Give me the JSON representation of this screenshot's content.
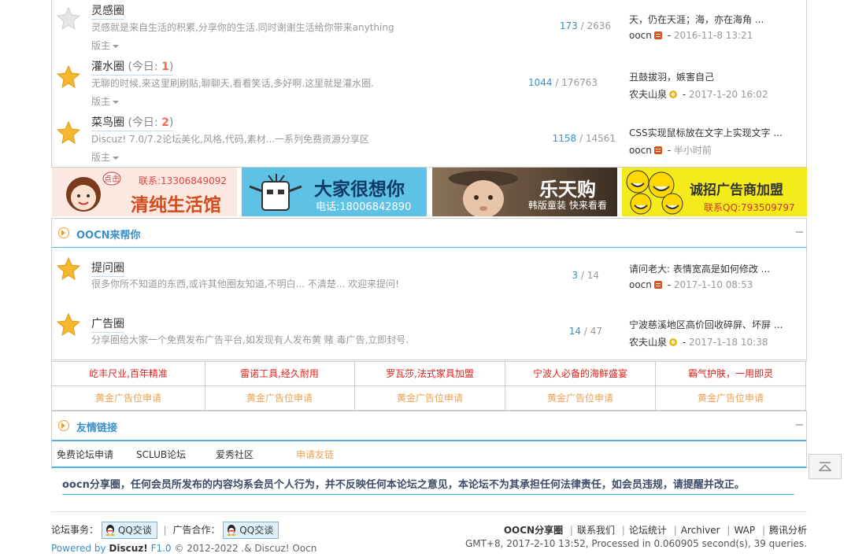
{
  "forums_top": [
    {
      "name": "灵感圈",
      "today": "",
      "today_label": "",
      "desc": "灵感就是来自生活的积累,分享你的生活.同时谢谢生活给你带来anything",
      "mod": "版主",
      "threads": "173",
      "posts": "2636",
      "last_title": "天，仍在天涯；海，亦在海角 ...",
      "last_user": "oocn",
      "last_time": "2016-11-8 13:21",
      "star": "gray",
      "medal": "red"
    },
    {
      "name": "灌水圈",
      "today": "1",
      "today_label": "今日: ",
      "desc": "无聊的时候,来这里刷刷贴,聊聊天,看看笑话,多好啊.这里就是灌水圈.",
      "mod": "版主",
      "threads": "1044",
      "posts": "176763",
      "last_title": "丑鼓拔羽，嫉害自己",
      "last_user": "农夫山泉",
      "last_time": "2017-1-20 16:02",
      "star": "gold",
      "medal": "gold"
    },
    {
      "name": "菜鸟圈",
      "today": "2",
      "today_label": "今日: ",
      "desc": "Discuz! 7.0/7.2论坛美化,风格,代码,素材...一系列免费资源分享区",
      "mod": "版主",
      "threads": "1158",
      "posts": "14561",
      "last_title": "CSS实现鼠标放在文字上实现文字 ...",
      "last_user": "oocn",
      "last_time": "半小时前",
      "star": "gold",
      "medal": "red"
    }
  ],
  "banners": [
    {
      "main": "清纯生活馆",
      "sub": "联系:13306849092",
      "bubble": "点击",
      "bg": "#fbe8e0"
    },
    {
      "main": "大家很想你",
      "sub": "电话:18006842890",
      "bg": "#5ec2e6"
    },
    {
      "main": "乐天购",
      "sub": "韩版童装 快来看看",
      "bg": "#6b5a48"
    },
    {
      "main": "诚招广告商加盟",
      "sub": "联系QQ:793509797",
      "bg": "#f5ea1a"
    }
  ],
  "section_help": {
    "title": "OOCN来帮你",
    "fold_icon": "collapse-icon"
  },
  "forums_help": [
    {
      "name": "提问圈",
      "desc": "很多你所不知道的东西,或许其他圈友知道,不明白... 不清楚... 欢迎来提问!",
      "threads": "3",
      "posts": "14",
      "last_title": "请问老大: 表情宽高是如何修改 ...",
      "last_user": "oocn",
      "last_time": "2017-1-10 08:53",
      "medal": "red"
    },
    {
      "name": "广告圈",
      "desc": "分享圈给大家一个免费发布广告平台,如发现有人发布黄 赌 毒广告,立即封号.",
      "threads": "14",
      "posts": "47",
      "last_title": "宁波慈溪地区高价回收碎屏、坏屏 ...",
      "last_user": "农夫山泉",
      "last_time": "2017-1-18 10:38",
      "medal": "gold"
    }
  ],
  "ads_row1": [
    "屹丰尺业,百年精准",
    "雷诺工具,经久耐用",
    "罗瓦莎,法式家具加盟",
    "宁波人必备的海鲜盛宴",
    "霸气护肤，一用即灵"
  ],
  "ads_row2": [
    "黄金广告位申请",
    "黄金广告位申请",
    "黄金广告位申请",
    "黄金广告位申请",
    "黄金广告位申请"
  ],
  "section_links": {
    "title": "友情链接"
  },
  "links": [
    "免费论坛申请",
    "SCLUB论坛",
    "爱秀社区",
    "申请友链"
  ],
  "notice": "oocn分享圈，任何会员所发布的内容均系会员个人行为，并不反映任何本论坛之意见，本论坛不为其承担任何法律责任，如会员违规，请提醒并改正。",
  "footer": {
    "affairs_label": "论坛事务：",
    "qq1": "QQ交谈",
    "sep": "|",
    "ad_label": "广告合作：",
    "qq2": "QQ交谈",
    "powered": "Powered by",
    "discuz": "Discuz!",
    "version": "F1.0",
    "copyright": "© 2012-2022 .& Discuz! Oocn",
    "nav": [
      "OOCN分享圈",
      "联系我们",
      "论坛统计",
      "Archiver",
      "WAP",
      "腾讯分析"
    ],
    "stats": "GMT+8, 2017-2-10 13:52, Processed in 0.060905 second(s), 39 queries."
  },
  "colors": {
    "link_blue": "#3a8fc6",
    "accent": "#4cb3e4",
    "today": "#f26c4f",
    "ad_red": "#e0211a",
    "ad_gold": "#f0a050"
  }
}
